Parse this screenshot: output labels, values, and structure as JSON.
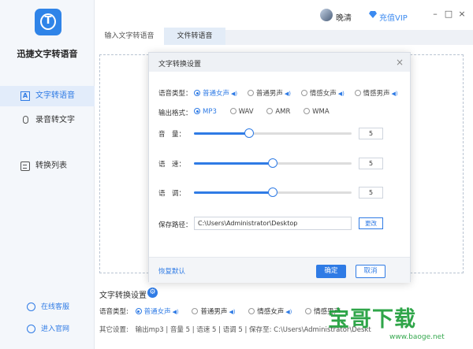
{
  "app": {
    "title": "迅捷文字转语音",
    "logo_letter": "T"
  },
  "sidebar": {
    "items": [
      {
        "label": "文字转语音",
        "icon": "text-a-icon",
        "active": true
      },
      {
        "label": "录音转文字",
        "icon": "microphone-icon",
        "active": false
      },
      {
        "label": "转换列表",
        "icon": "list-icon",
        "active": false
      }
    ],
    "bottom": [
      {
        "label": "在线客服",
        "icon": "headset-icon"
      },
      {
        "label": "进入官网",
        "icon": "globe-icon"
      }
    ]
  },
  "topbar": {
    "username": "晚清",
    "vip_label": "充值VIP",
    "minimize": "–",
    "maximize": "□",
    "close": "×"
  },
  "tabs": [
    {
      "label": "输入文字转语音",
      "active": false
    },
    {
      "label": "文件转语音",
      "active": true
    }
  ],
  "bottom_panel": {
    "title": "文字转换设置",
    "voice_label": "语音类型:",
    "voice_options": [
      "普通女声",
      "普通男声",
      "情感女声",
      "情感男声"
    ],
    "voice_selected": "普通女声",
    "other_label": "其它设置:",
    "other_text": "输出mp3 | 音量 5 | 语速 5 | 语调 5 | 保存至: C:\\Users\\Administrator\\Deskt"
  },
  "modal": {
    "title": "文字转换设置",
    "close": "×",
    "voice_type_label": "语音类型：",
    "voice_options": [
      "普通女声",
      "普通男声",
      "情感女声",
      "情感男声"
    ],
    "voice_selected": "普通女声",
    "format_label": "输出格式：",
    "format_options": [
      "MP3",
      "WAV",
      "AMR",
      "WMA"
    ],
    "format_selected": "MP3",
    "volume_label": "音　量：",
    "volume_value": "5",
    "volume_fraction": 0.35,
    "speed_label": "语　速：",
    "speed_value": "5",
    "speed_fraction": 0.5,
    "pitch_label": "语　调：",
    "pitch_value": "5",
    "pitch_fraction": 0.5,
    "path_label": "保存路径：",
    "path_value": "C:\\Users\\Administrator\\Desktop",
    "browse_label": "更改",
    "reset_label": "恢复默认",
    "ok_label": "确定",
    "cancel_label": "取消"
  },
  "watermark": {
    "text": "宝哥下载",
    "url": "www.baoge.net"
  },
  "colors": {
    "accent": "#2f7be5",
    "watermark": "#1e9e3a"
  }
}
